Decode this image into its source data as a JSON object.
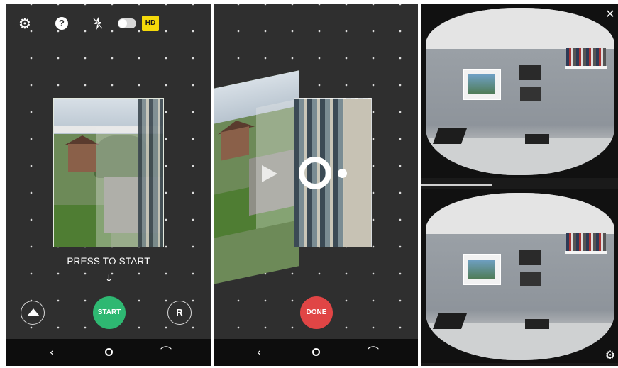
{
  "screens": {
    "capture": {
      "toolbar": {
        "settings_icon": "gear-icon",
        "help_glyph": "?",
        "flash_icon": "flash-off-icon",
        "mode_toggle": "toggle-icon",
        "hd_label": "HD"
      },
      "hint_text": "PRESS TO START",
      "arrow_glyph": "↓",
      "gallery_icon": "gallery-icon",
      "start_label": "START",
      "r_label": "R",
      "nav": {
        "back_glyph": "‹",
        "recents_glyph": "⌒"
      }
    },
    "panning": {
      "done_label": "DONE",
      "nav": {
        "back_glyph": "‹",
        "recents_glyph": "⌒"
      }
    },
    "preview": {
      "close_glyph": "✕",
      "settings_glyph": "⚙"
    }
  },
  "colors": {
    "start_button": "#2eb872",
    "done_button": "#e04545",
    "hd_badge": "#f5d90a",
    "panel_bg": "#2f2f2f"
  }
}
